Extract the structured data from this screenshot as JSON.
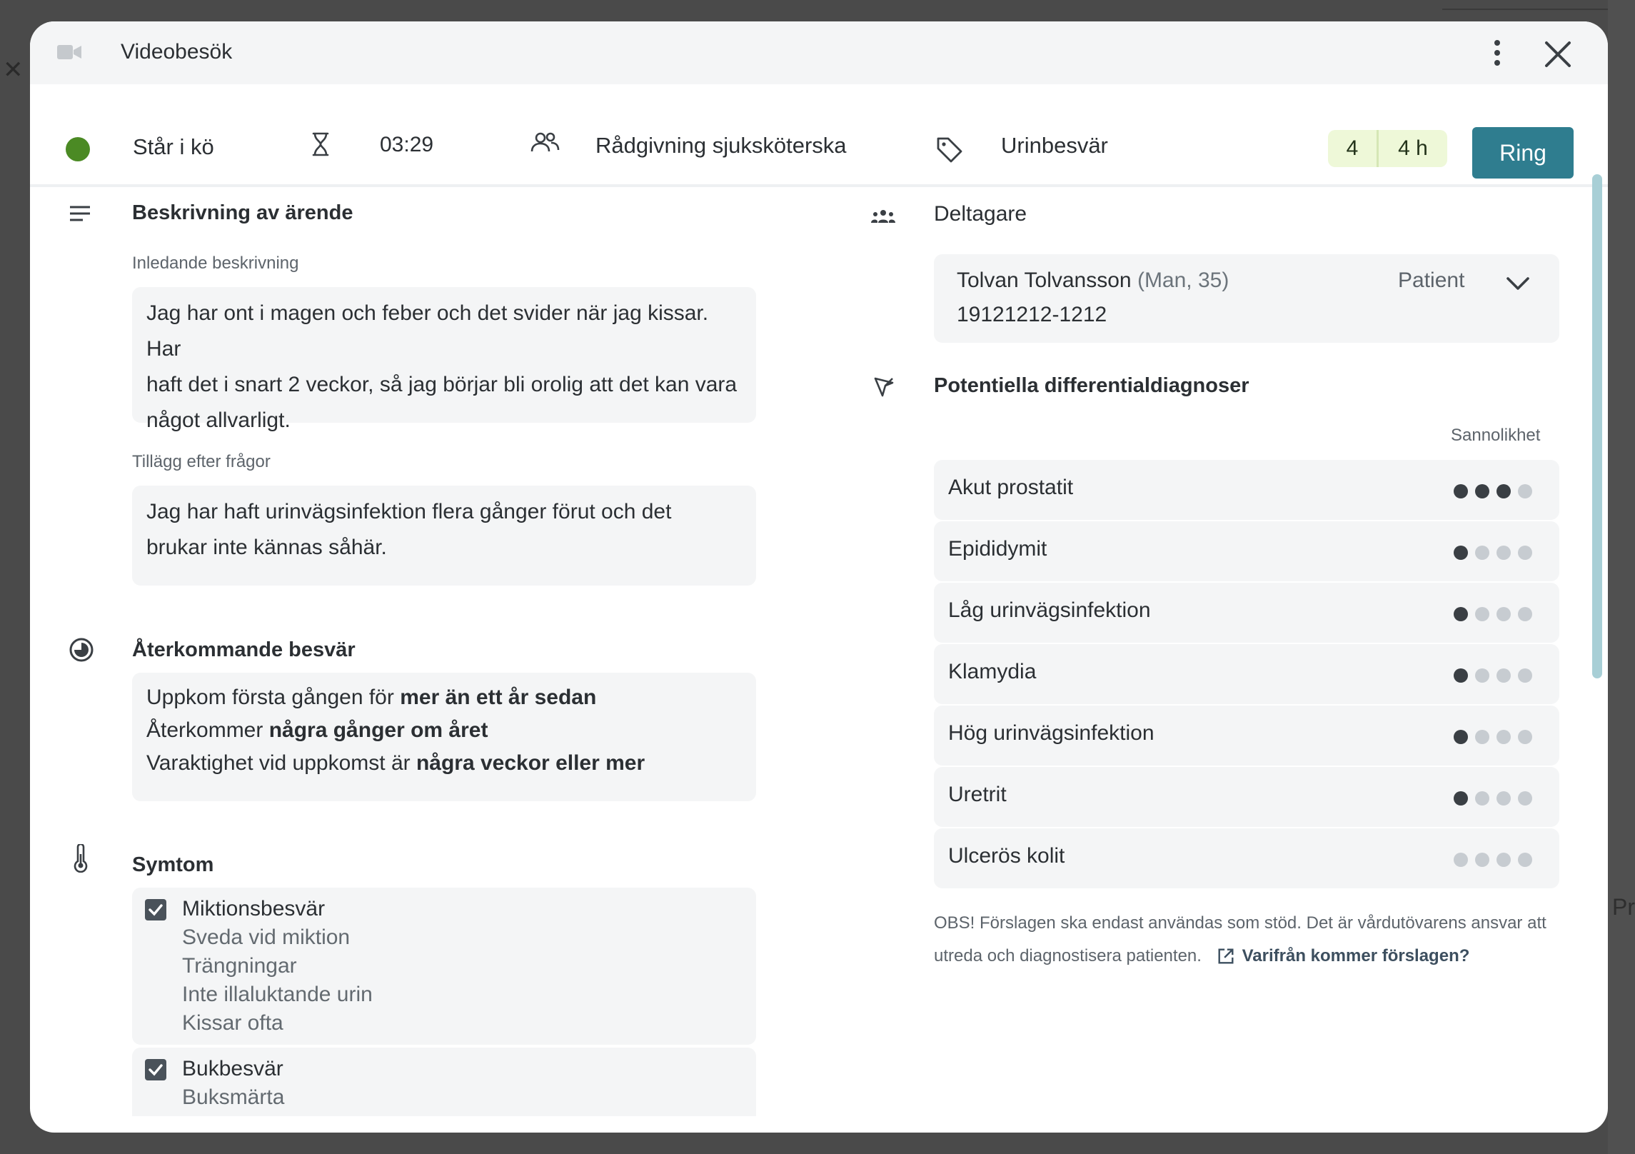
{
  "window": {
    "title": "Videobesök"
  },
  "status": {
    "state": "Står i kö",
    "wait_time": "03:29",
    "queue": "Rådgivning sjuksköterska",
    "tag": "Urinbesvär",
    "priority_value": "4",
    "priority_time": "4 h",
    "call_label": "Ring",
    "state_color": "#4b8a24",
    "call_color": "#2f7d8f"
  },
  "description": {
    "heading": "Beskrivning av ärende",
    "initial_label": "Inledande beskrivning",
    "initial_lines": [
      "Jag har ont i magen och feber och det svider när jag kissar. Har",
      "haft det i snart 2 veckor, så jag börjar bli orolig att det kan vara",
      "något allvarligt."
    ],
    "followup_label": "Tillägg efter frågor",
    "followup_lines": [
      "Jag har haft urinvägsinfektion flera gånger förut och det",
      "brukar inte kännas såhär."
    ]
  },
  "recurring": {
    "heading": "Återkommande besvär",
    "lines": [
      {
        "prefix": "Uppkom första gången för ",
        "bold": "mer än ett år sedan"
      },
      {
        "prefix": "Återkommer ",
        "bold": "några gånger om året"
      },
      {
        "prefix": "Varaktighet vid uppkomst är ",
        "bold": "några veckor eller mer"
      }
    ]
  },
  "symptoms": {
    "heading": "Symtom",
    "groups": [
      {
        "title": "Miktionsbesvär",
        "checked": true,
        "items": [
          "Sveda vid miktion",
          "Trängningar",
          "Inte illaluktande urin",
          "Kissar ofta"
        ]
      },
      {
        "title": "Bukbesvär",
        "checked": true,
        "items": [
          "Buksmärta"
        ]
      }
    ]
  },
  "participants": {
    "heading": "Deltagare",
    "patient_name": "Tolvan Tolvansson",
    "patient_meta": "(Man, 35)",
    "patient_id": "19121212-1212",
    "role": "Patient"
  },
  "diagnoses": {
    "heading": "Potentiella differentialdiagnoser",
    "probability_label": "Sannolikhet",
    "items": [
      {
        "name": "Akut prostatit",
        "level": 3
      },
      {
        "name": "Epididymit",
        "level": 1
      },
      {
        "name": "Låg urinvägsinfektion",
        "level": 1
      },
      {
        "name": "Klamydia",
        "level": 1
      },
      {
        "name": "Hög urinvägsinfektion",
        "level": 1
      },
      {
        "name": "Uretrit",
        "level": 1
      },
      {
        "name": "Ulcerös kolit",
        "level": 0
      }
    ],
    "max_level": 4,
    "disclaimer_line1": "OBS! Förslagen ska endast användas som stöd. Det är vårdutövarens ansvar att",
    "disclaimer_line2": "utreda och diagnostisera patienten.",
    "source_link": "Varifrån kommer förslagen?"
  },
  "background": {
    "partial_text": "Pr"
  },
  "icons": [
    "video-camera-icon",
    "more-vertical-icon",
    "close-icon",
    "hourglass-icon",
    "group-icon",
    "tag-icon",
    "text-lines-icon",
    "recurring-clock-icon",
    "thermometer-icon",
    "participants-icon",
    "diagnosis-icon",
    "chevron-down-icon",
    "external-link-icon",
    "checkbox-icon"
  ]
}
